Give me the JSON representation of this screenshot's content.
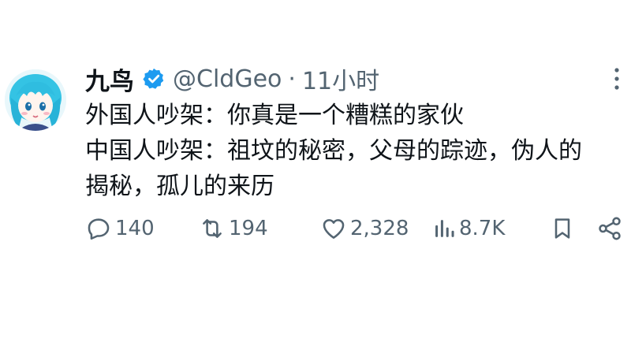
{
  "tweet": {
    "author": {
      "display_name": "九鸟",
      "handle": "@CldGeo",
      "verified": true,
      "avatar_icon": "anime-avatar"
    },
    "separator": "·",
    "time": "11小时",
    "text_lines": [
      "外国人吵架：你真是一个糟糕的家伙",
      "中国人吵架：祖坟的秘密，父母的踪迹，伪人的",
      "揭秘，孤儿的来历"
    ],
    "more_icon": "more-vertical-icon"
  },
  "actions": {
    "reply": {
      "icon": "reply-icon",
      "count": "140"
    },
    "retweet": {
      "icon": "retweet-icon",
      "count": "194"
    },
    "like": {
      "icon": "heart-icon",
      "count": "2,328"
    },
    "views": {
      "icon": "views-icon",
      "count": "8.7K"
    },
    "bookmark": {
      "icon": "bookmark-icon"
    },
    "share": {
      "icon": "share-icon"
    }
  },
  "colors": {
    "verified_badge": "#1d9bf0",
    "secondary_text": "#536471",
    "primary_text": "#0f1419",
    "background": "#ffffff"
  }
}
